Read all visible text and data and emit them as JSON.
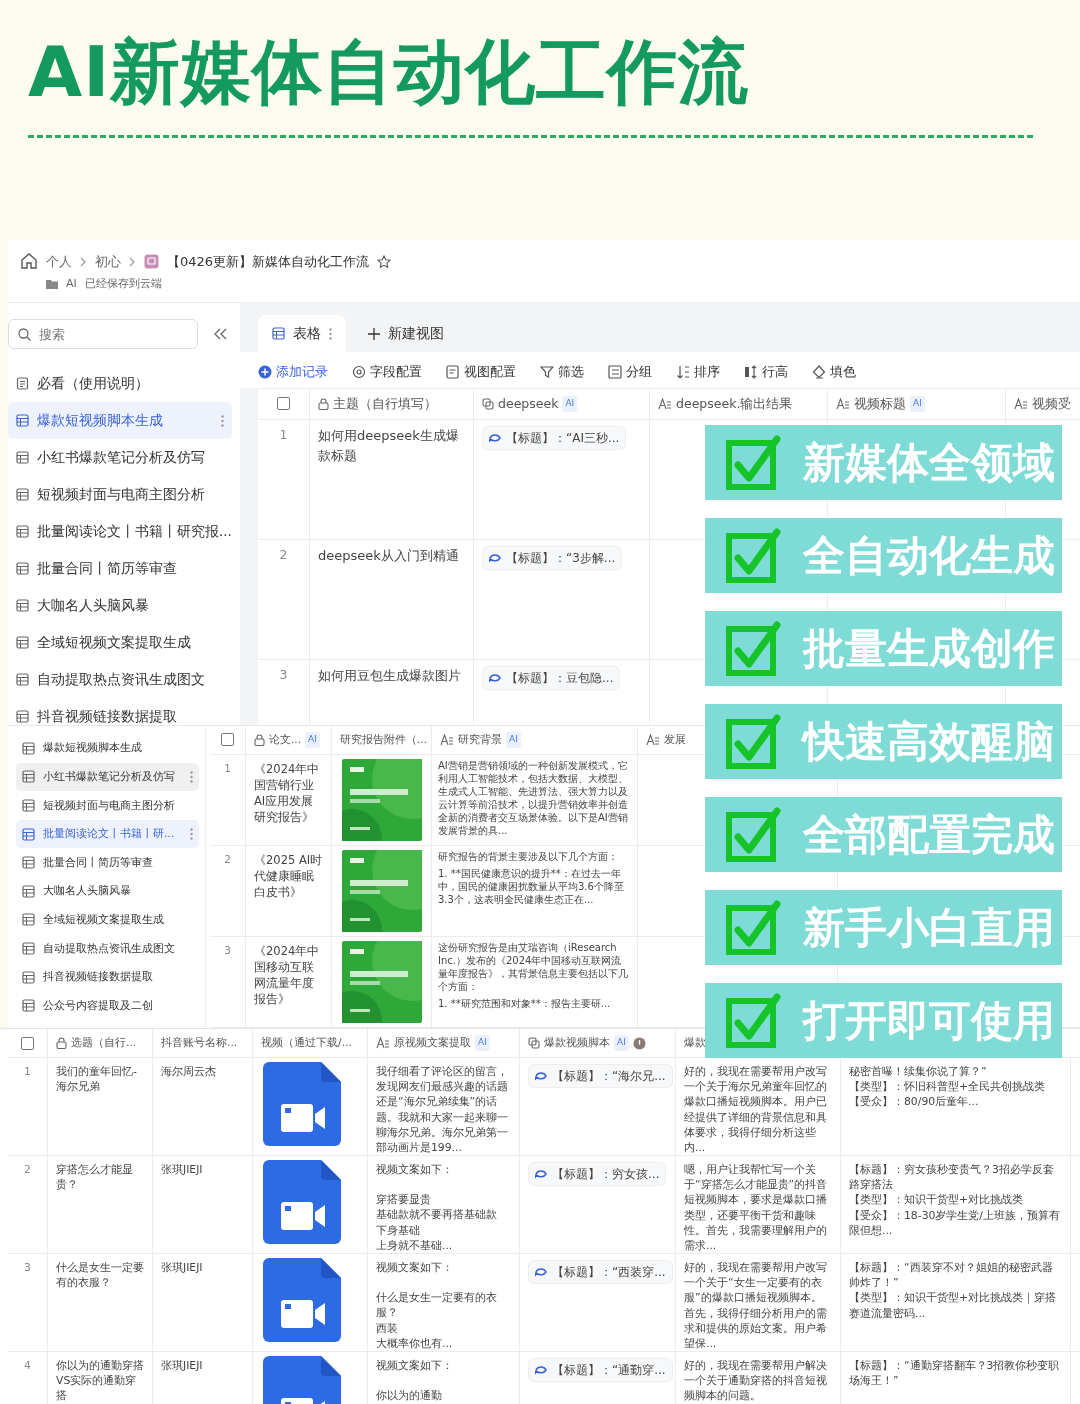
{
  "headline": "AI新媒体自动化工作流",
  "doc": {
    "breadcrumb": [
      "个人",
      "初心"
    ],
    "title": "【0426更新】新媒体自动化工作流",
    "folder": "AI",
    "save_status": "已经保存到云端"
  },
  "sidebar": {
    "search_placeholder": "搜索",
    "items": [
      {
        "label": "必看（使用说明）",
        "selected": false,
        "kind": "doc"
      },
      {
        "label": "爆款短视频脚本生成",
        "selected": true,
        "kind": "table"
      },
      {
        "label": "小红书爆款笔记分析及仿写",
        "selected": false,
        "kind": "table"
      },
      {
        "label": "短视频封面与电商主图分析",
        "selected": false,
        "kind": "table"
      },
      {
        "label": "批量阅读论文丨书籍丨研究报...",
        "selected": false,
        "kind": "table"
      },
      {
        "label": "批量合同丨简历等审查",
        "selected": false,
        "kind": "table"
      },
      {
        "label": "大咖名人头脑风暴",
        "selected": false,
        "kind": "table"
      },
      {
        "label": "全域短视频文案提取生成",
        "selected": false,
        "kind": "table"
      },
      {
        "label": "自动提取热点资讯生成图文",
        "selected": false,
        "kind": "table"
      },
      {
        "label": "抖音视频链接数据提取",
        "selected": false,
        "kind": "table"
      }
    ]
  },
  "view_tabs": [
    {
      "label": "表格",
      "selected": true,
      "kind": "tab"
    },
    {
      "label": "新建视图",
      "selected": false,
      "kind": "add"
    }
  ],
  "toolbar": [
    {
      "label": "添加记录",
      "kind": "primary"
    },
    {
      "label": "字段配置",
      "kind": "tool"
    },
    {
      "label": "视图配置",
      "kind": "tool"
    },
    {
      "label": "筛选",
      "kind": "tool"
    },
    {
      "label": "分组",
      "kind": "tool"
    },
    {
      "label": "排序",
      "kind": "tool"
    },
    {
      "label": "行高",
      "kind": "tool"
    },
    {
      "label": "填色",
      "kind": "tool"
    }
  ],
  "table1": {
    "all_checked": false,
    "columns": [
      {
        "label": "主题（自行填写）",
        "kind": "lock"
      },
      {
        "label": "deepseek",
        "kind": "link",
        "badge": "AI"
      },
      {
        "label": "deepseek.输出结果",
        "kind": "text"
      },
      {
        "label": "视频标题",
        "kind": "text",
        "badge": "AI"
      },
      {
        "label": "视频受",
        "kind": "text"
      }
    ],
    "rows": [
      {
        "num": "1",
        "topic": "如何用deepseek生成爆款标题",
        "tag": "【标题】：“AI三秒..."
      },
      {
        "num": "2",
        "topic": "deepseek从入门到精通",
        "tag": "【标题】：“3步解..."
      },
      {
        "num": "3",
        "topic": "如何用豆包生成爆款图片",
        "tag": "【标题】：豆包隐..."
      }
    ]
  },
  "panel2": {
    "sidebar": [
      {
        "label": "爆款短视频脚本生成",
        "selected": false
      },
      {
        "label": "小红书爆款笔记分析及仿写",
        "selected": false,
        "hovered": true
      },
      {
        "label": "短视频封面与电商主图分析",
        "selected": false
      },
      {
        "label": "批量阅读论文丨书籍丨研...",
        "selected": true
      },
      {
        "label": "批量合同丨简历等审查",
        "selected": false
      },
      {
        "label": "大咖名人头脑风暴",
        "selected": false
      },
      {
        "label": "全域短视频文案提取生成",
        "selected": false
      },
      {
        "label": "自动提取热点资讯生成图文",
        "selected": false
      },
      {
        "label": "抖音视频链接数据提取",
        "selected": false
      },
      {
        "label": "公众号内容提取及二创",
        "selected": false
      }
    ],
    "all_checked": false,
    "columns": [
      {
        "label": "论文...",
        "kind": "lock",
        "badge": "AI"
      },
      {
        "label": "研究报告附件（...",
        "kind": "plain"
      },
      {
        "label": "研究背景",
        "kind": "text",
        "badge": "AI"
      },
      {
        "label": "发展",
        "kind": "text"
      }
    ],
    "rows": [
      {
        "num": "1",
        "title": "《2024年中国营销行业AI应用发展研究报告》",
        "background": [
          "AI营销是营销领域的一种创新发展模式，它利用人工智能技术，包括大数据、大模型、生成式人工智能、先进算法、强大算力以及云计算等前沿技术，以提升营销效率并创造全新的消费者交互场景体验。以下是AI营销发展背景的具..."
        ]
      },
      {
        "num": "2",
        "title": "《2025 AI时代健康睡眠白皮书》",
        "background": [
          "研究报告的背景主要涉及以下几个方面：",
          "1. **国民健康意识的提升**：在过去一年中，国民的健康困扰数量从平均3.6个降至3.3个，这表明全民健康生态正在..."
        ]
      },
      {
        "num": "3",
        "title": "《2024年中国移动互联网流量年度报告》",
        "background": [
          "这份研究报告是由艾瑞咨询（iResearch Inc.）发布的《2024年中国移动互联网流量年度报告》，其背景信息主要包括以下几个方面：",
          "1. **研究范围和对象**：报告主要研..."
        ]
      }
    ]
  },
  "panel3": {
    "all_checked": false,
    "columns": [
      {
        "label": "选题（自行...",
        "kind": "lock"
      },
      {
        "label": "抖音账号名称...",
        "kind": "plain"
      },
      {
        "label": "视频（通过下载/...",
        "kind": "plain"
      },
      {
        "label": "原视频文案提取",
        "kind": "text",
        "badge": "AI"
      },
      {
        "label": "爆款视频脚本",
        "kind": "link",
        "badge": "AI",
        "warning": true
      },
      {
        "label": "爆款",
        "kind": "plain"
      }
    ],
    "rows": [
      {
        "num": "1",
        "topic": "我们的童年回忆-海尔兄弟",
        "account": "海尔周云杰",
        "transcript": [
          "我仔细看了评论区的留言，发现网友们最感兴趣的话题还是“海尔兄弟续集”的话题。我就和大家一起来聊一聊海尔兄弟。海尔兄弟第一部动画片是199..."
        ],
        "tag": "【标题】：“海尔兄...",
        "script": "好的，我现在需要帮用户改写一个关于海尔兄弟童年回忆的爆款口播短视频脚本。用户已经提供了详细的背景信息和具体要求，我得仔细分析这些内...",
        "outline": [
          "秘密首曝！续集你说了算？”",
          "【类型】：怀旧科普型+全民共创挑战类",
          "【受众】：80/90后童年..."
        ]
      },
      {
        "num": "2",
        "topic": "穿搭怎么才能显贵？",
        "account": "张琪JIEJI",
        "transcript": [
          "视频文案如下：",
          "穿搭要显贵",
          "基础款就不要再搭基础款",
          "下身基础",
          "上身就不基础..."
        ],
        "tag": "【标题】：穷女孩...",
        "script": "嗯，用户让我帮忙写一个关于“穿搭怎么才能显贵”的抖音短视频脚本，要求是爆款口播类型，还要平衡干货和趣味性。首先，我需要理解用户的需求...",
        "outline": [
          "【标题】：穷女孩秒变贵气？3招必学反套路穿搭法",
          "【类型】：知识干货型+对比挑战类",
          "【受众】：18-30岁学生党/上班族，预算有限但想..."
        ]
      },
      {
        "num": "3",
        "topic": "什么是女生一定要有的衣服？",
        "account": "张琪JIEJI",
        "transcript": [
          "视频文案如下：",
          "什么是女生一定要有的衣服？",
          "西装",
          "大概率你也有..."
        ],
        "tag": "【标题】：“西装穿...",
        "script": "好的，我现在需要帮用户改写一个关于“女生一定要有的衣服”的爆款口播短视频脚本。首先，我得仔细分析用户的需求和提供的原始文案。用户希望保...",
        "outline": [
          "【标题】：“西装穿不对？姐姐的秘密武器帅炸了！”",
          "【类型】：知识干货型+对比挑战类｜穿搭赛道流量密码..."
        ]
      },
      {
        "num": "4",
        "topic": "你以为的通勤穿搭VS实际的通勤穿搭",
        "account": "张琪JIEJI",
        "transcript": [
          "视频文案如下：",
          "你以为的通勤"
        ],
        "tag": "【标题】：“通勤穿...",
        "script": "好的，我现在需要帮用户解决一个关于通勤穿搭的抖音短视频脚本的问题。",
        "outline": [
          "【标题】：“通勤穿搭翻车？3招教你秒变职场海王！”"
        ]
      }
    ]
  },
  "banners": [
    "新媒体全领域",
    "全自动化生成",
    "批量生成创作",
    "快速高效醒脑",
    "全部配置完成",
    "新手小白直用",
    "打开即可使用"
  ]
}
